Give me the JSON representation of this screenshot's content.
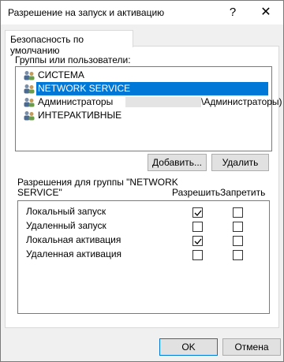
{
  "window": {
    "title": "Разрешение на запуск и активацию",
    "help_label": "?",
    "close_label": "✕"
  },
  "tab": {
    "label": "Безопасность по умолчанию"
  },
  "groups": {
    "label": "Группы или пользователи:",
    "items": [
      {
        "name": "СИСТЕМА",
        "selected": false
      },
      {
        "name": "NETWORK SERVICE",
        "selected": true
      },
      {
        "name": "Администраторы",
        "suffix": "\\Администраторы)",
        "selected": false
      },
      {
        "name": "ИНТЕРАКТИВНЫЕ",
        "selected": false
      }
    ],
    "add_label": "Добавить...",
    "remove_label": "Удалить"
  },
  "permissions": {
    "label_line1": "Разрешения для группы \"NETWORK",
    "label_line2": "SERVICE\"",
    "allow_header": "Разрешить",
    "deny_header": "Запретить",
    "rows": [
      {
        "name": "Локальный запуск",
        "allow": true,
        "deny": false
      },
      {
        "name": "Удаленный запуск",
        "allow": false,
        "deny": false
      },
      {
        "name": "Локальная активация",
        "allow": true,
        "deny": false
      },
      {
        "name": "Удаленная активация",
        "allow": false,
        "deny": false
      }
    ]
  },
  "footer": {
    "ok_label": "OK",
    "cancel_label": "Отмена"
  },
  "colors": {
    "selection": "#0078d7",
    "background": "#f0f0f0"
  }
}
